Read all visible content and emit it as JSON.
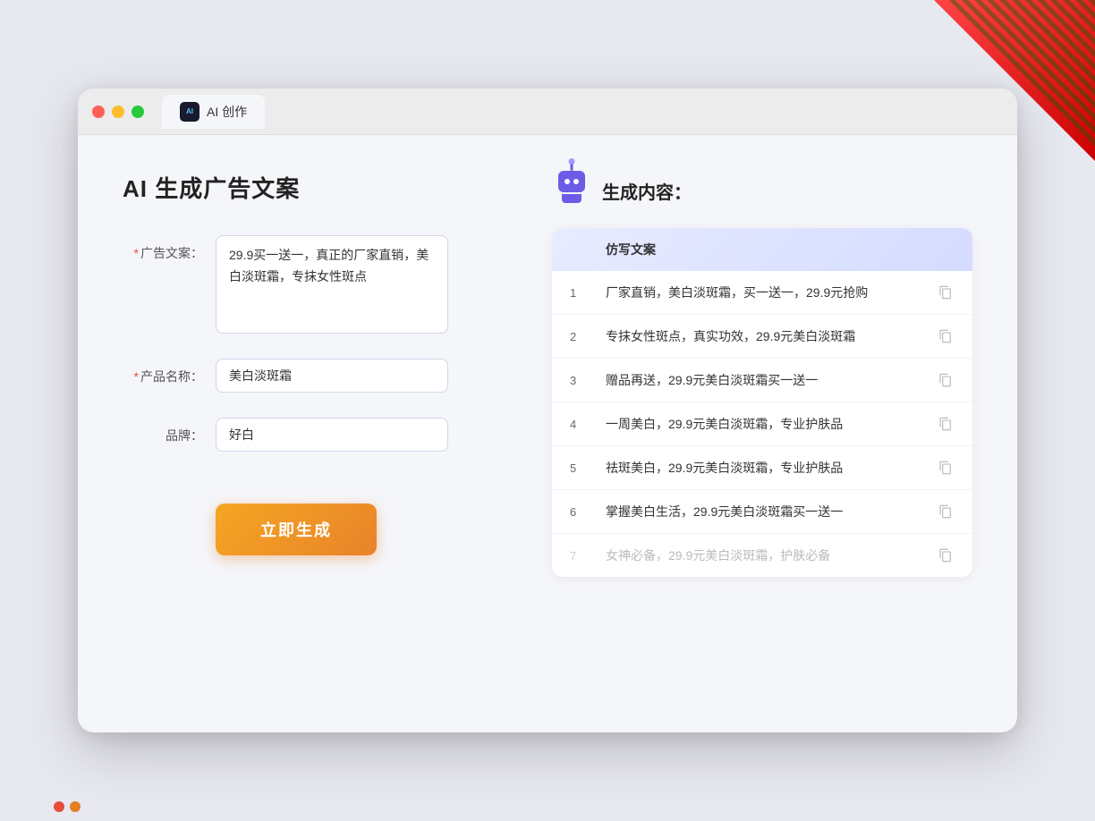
{
  "window": {
    "tab_title": "AI 创作",
    "controls": {
      "close": "close",
      "minimize": "minimize",
      "maximize": "maximize"
    }
  },
  "left_panel": {
    "title": "AI 生成广告文案",
    "form": {
      "ad_copy_label": "广告文案：",
      "ad_copy_required": "*",
      "ad_copy_value": "29.9买一送一，真正的厂家直销，美白淡斑霜，专抹女性斑点",
      "product_name_label": "产品名称：",
      "product_name_required": "*",
      "product_name_value": "美白淡斑霜",
      "brand_label": "品牌：",
      "brand_value": "好白"
    },
    "generate_button": "立即生成"
  },
  "right_panel": {
    "title": "生成内容：",
    "results_header": "仿写文案",
    "results": [
      {
        "num": "1",
        "text": "厂家直销，美白淡斑霜，买一送一，29.9元抢购",
        "faded": false
      },
      {
        "num": "2",
        "text": "专抹女性斑点，真实功效，29.9元美白淡斑霜",
        "faded": false
      },
      {
        "num": "3",
        "text": "赠品再送，29.9元美白淡斑霜买一送一",
        "faded": false
      },
      {
        "num": "4",
        "text": "一周美白，29.9元美白淡斑霜，专业护肤品",
        "faded": false
      },
      {
        "num": "5",
        "text": "祛斑美白，29.9元美白淡斑霜，专业护肤品",
        "faded": false
      },
      {
        "num": "6",
        "text": "掌握美白生活，29.9元美白淡斑霜买一送一",
        "faded": false
      },
      {
        "num": "7",
        "text": "女神必备，29.9元美白淡斑霜，护肤必备",
        "faded": true
      }
    ]
  }
}
